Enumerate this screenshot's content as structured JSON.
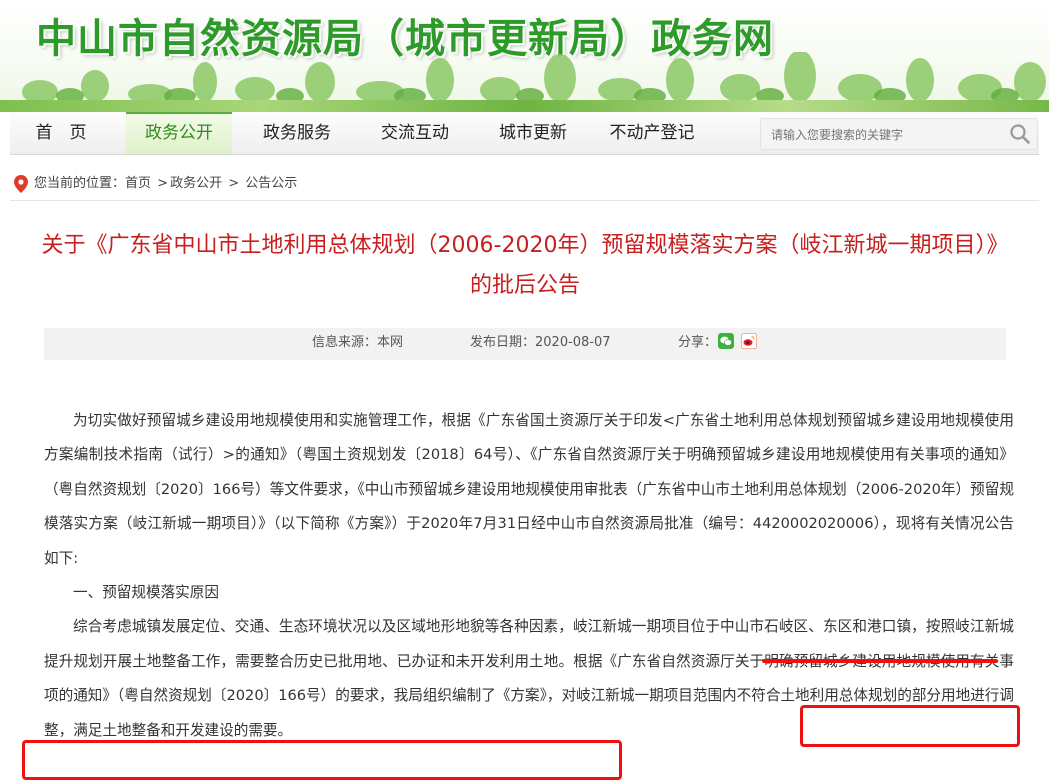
{
  "site": {
    "title": "中山市自然资源局（城市更新局）政务网"
  },
  "nav": {
    "items": [
      {
        "label": "首　页"
      },
      {
        "label": "政务公开"
      },
      {
        "label": "政务服务"
      },
      {
        "label": "交流互动"
      },
      {
        "label": "城市更新"
      },
      {
        "label": "不动产登记"
      }
    ],
    "active_index": 1,
    "search_placeholder": "请输入您要搜索的关键字",
    "search_icon": "search-icon"
  },
  "breadcrumb": {
    "prefix": "您当前的位置：",
    "items": [
      "首页",
      "政务公开",
      "公告公示"
    ],
    "separator": ">"
  },
  "article": {
    "title": "关于《广东省中山市土地利用总体规划（2006-2020年）预留规模落实方案（岐江新城一期项目）》的批后公告",
    "source_label": "信息来源：本网",
    "date_label": "发布日期：2020-08-07",
    "share_label": "分享：",
    "share_icons": [
      "wechat-icon",
      "weibo-icon"
    ],
    "paragraph1": "为切实做好预留城乡建设用地规模使用和实施管理工作，根据《广东省国土资源厅关于印发<广东省土地利用总体规划预留城乡建设用地规模使用方案编制技术指南（试行）>的通知》（粤国土资规划发〔2018〕64号）、《广东省自然资源厅关于明确预留城乡建设用地规模使用有关事项的通知》（粤自然资规划〔2020〕166号）等文件要求，《中山市预留城乡建设用地规模使用审批表（广东省中山市土地利用总体规划（2006-2020年）预留规模落实方案（岐江新城一期项目）》（以下简称《方案》）于2020年7月31日经中山市自然资源局批准（编号：4420002020006），现将有关情况公告如下:",
    "section1_heading": "一、预留规模落实原因",
    "paragraph2": "综合考虑城镇发展定位、交通、生态环境状况以及区域地形地貌等各种因素，岐江新城一期项目位于中山市石岐区、东区和港口镇，按照岐江新城提升规划开展土地整备工作，需要整合历史已批用地、已办证和未开发利用土地。根据《广东省自然资源厅关于明确预留城乡建设用地规模使用有关事项的通知》（粤自然资规划〔2020〕166号）的要求，我局组织编制了《方案》，对岐江新城一期项目范围内不符合土地利用总体规划的部分用地进行调整，满足土地整备和开发建设的需要。"
  },
  "colors": {
    "brand_green": "#2e9a2a",
    "title_red": "#c81e1e",
    "annotation_red": "#ee1111"
  }
}
